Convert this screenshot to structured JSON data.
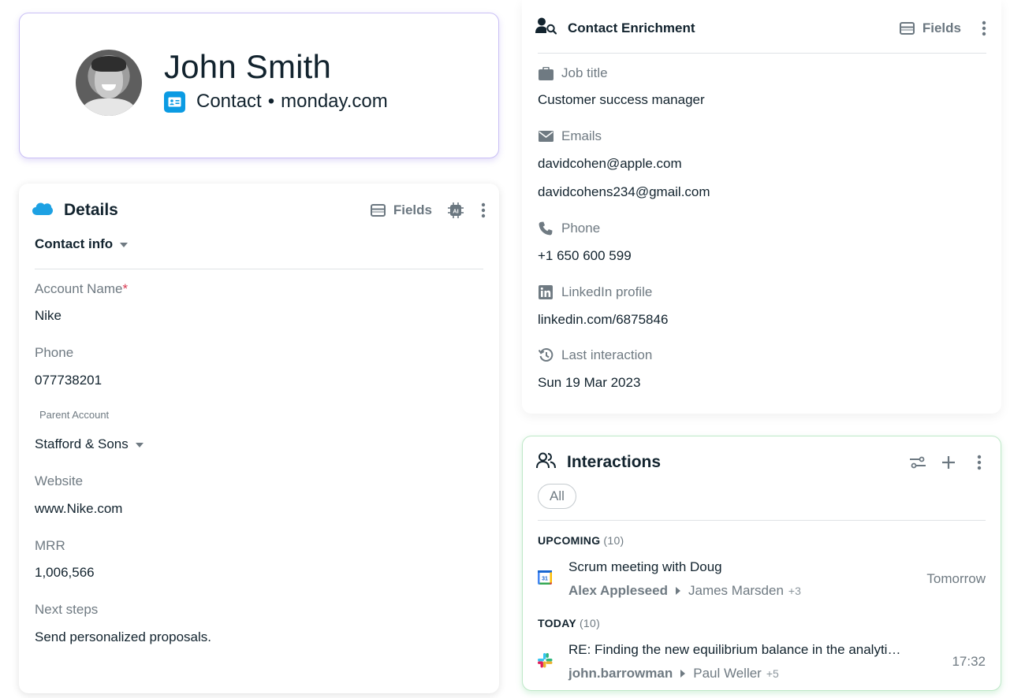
{
  "profile": {
    "name": "John Smith",
    "type": "Contact",
    "separator": "•",
    "company": "monday.com"
  },
  "details": {
    "title": "Details",
    "fields_label": "Fields",
    "section_label": "Contact info",
    "fields": [
      {
        "label": "Account Name",
        "required_mark": "*",
        "value": "Nike"
      },
      {
        "label": "Phone",
        "value": "077738201"
      },
      {
        "label": "Parent Account",
        "value": "Stafford & Sons"
      },
      {
        "label": "Website",
        "value": "www.Nike.com"
      },
      {
        "label": "MRR",
        "value": "1,006,566"
      },
      {
        "label": "Next steps",
        "value": "Send personalized proposals."
      }
    ],
    "ai_badge": "AI"
  },
  "enrichment": {
    "title": "Contact Enrichment",
    "fields_label": "Fields",
    "job_title": {
      "label": "Job title",
      "value": "Customer success manager"
    },
    "emails": {
      "label": "Emails",
      "values": [
        "davidcohen@apple.com",
        "davidcohens234@gmail.com"
      ]
    },
    "phone": {
      "label": "Phone",
      "value": "+1 650 600 599"
    },
    "linkedin": {
      "label": "LinkedIn profile",
      "value": "linkedin.com/6875846"
    },
    "last_interaction": {
      "label": "Last interaction",
      "value": "Sun 19 Mar 2023"
    }
  },
  "interactions": {
    "title": "Interactions",
    "filter_all": "All",
    "sections": [
      {
        "heading": "UPCOMING",
        "count": "(10)",
        "item": {
          "title": "Scrum meeting with Doug",
          "from": "Alex Appleseed",
          "to": "James Marsden",
          "more": "+3",
          "time": "Tomorrow",
          "calendar_day": "31"
        }
      },
      {
        "heading": "TODAY",
        "count": "(10)",
        "item": {
          "title": "RE: Finding the new equilibrium balance in the analyti…",
          "from": "john.barrowman",
          "to": "Paul Weller",
          "more": "+5",
          "time": "17:32"
        }
      }
    ]
  }
}
